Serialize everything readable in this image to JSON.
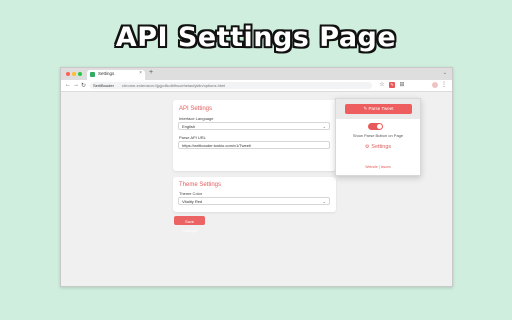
{
  "banner": {
    "title": "API Settings Page"
  },
  "browser": {
    "tab_title": "Settings",
    "tab_close": "×",
    "new_tab": "+",
    "omnibox_chip": "SeriiBouder",
    "url": "chrome-extension://jpjpdikolbfhsoehelaufykiln/options.html"
  },
  "api_settings": {
    "title": "API Settings",
    "language_label": "Interface Language",
    "language_value": "English",
    "url_label": "Parse API URL",
    "url_value": "https://writbouder.tonkio.com/v1/Tweet/"
  },
  "theme_settings": {
    "title": "Theme Settings",
    "color_label": "Theme Color",
    "color_value": "Vitality Red"
  },
  "save_label": "Save Settings",
  "popup": {
    "post_label": "Parse Tweet",
    "toggle_label": "Show Parse Button on Page",
    "settings_label": "Settings",
    "footer": "Website | Issues"
  },
  "colors": {
    "accent": "#e85a5a",
    "background": "#cfeedd"
  }
}
